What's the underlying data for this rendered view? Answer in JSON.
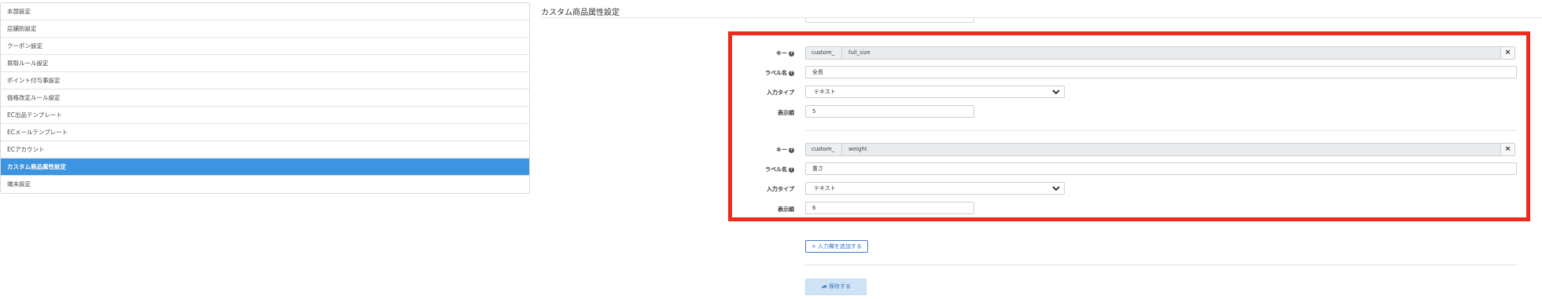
{
  "sidebar": {
    "items": [
      {
        "label": "本部設定"
      },
      {
        "label": "店舗別設定"
      },
      {
        "label": "クーポン設定"
      },
      {
        "label": "買取ルール設定"
      },
      {
        "label": "ポイント付与事設定"
      },
      {
        "label": "価格改定ルール設定"
      },
      {
        "label": "EC出品テンプレート"
      },
      {
        "label": "ECメールテンプレート"
      },
      {
        "label": "ECアカウント"
      },
      {
        "label": "カスタム商品属性設定",
        "active": true
      },
      {
        "label": "端末設定"
      }
    ]
  },
  "page": {
    "title": "カスタム商品属性設定"
  },
  "form": {
    "labels": {
      "key": "キー",
      "label_name": "ラベル名",
      "input_type": "入力タイプ",
      "display_order": "表示順"
    },
    "help_icon": "question-circle-icon",
    "remove_icon": "×",
    "attributes": [
      {
        "key_prefix": "custom_",
        "key": "full_size",
        "label": "全長",
        "input_type": "テキスト",
        "order": "5"
      },
      {
        "key_prefix": "custom_",
        "key": "weight",
        "label": "重さ",
        "input_type": "テキスト",
        "order": "6"
      }
    ],
    "add_button": "+ 入力欄を追加する",
    "save_button": "保存する",
    "save_icon": "share-icon"
  },
  "colors": {
    "accent": "#3d94e0",
    "highlight_border": "#ee2a1e",
    "save_bg": "#cfe3f6"
  }
}
